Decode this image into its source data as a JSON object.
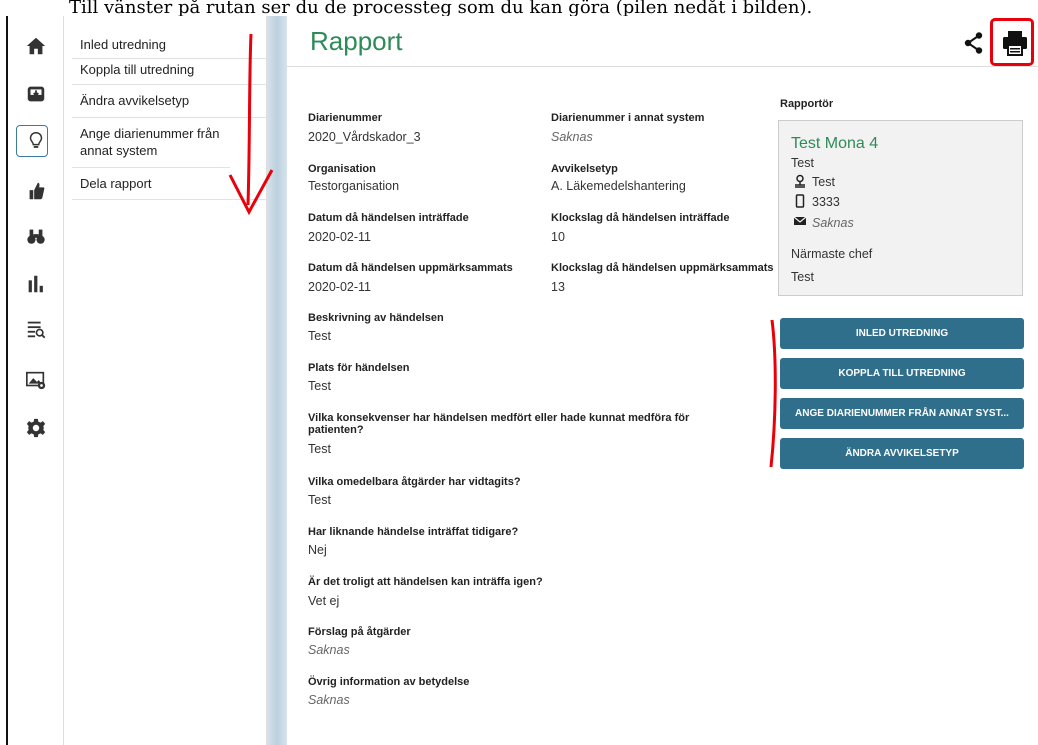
{
  "caption": "Till vänster på rutan ser du de processteg som du kan göra (pilen nedåt i bilden).",
  "rail": {
    "items": [
      {
        "icon": "home-icon"
      },
      {
        "icon": "inbox-icon"
      },
      {
        "icon": "lightbulb-icon",
        "active": true
      },
      {
        "icon": "thumbs-up-icon"
      },
      {
        "icon": "binoculars-icon"
      },
      {
        "icon": "bar-chart-icon"
      },
      {
        "icon": "search-list-icon"
      },
      {
        "icon": "image-settings-icon"
      },
      {
        "icon": "gear-icon"
      }
    ]
  },
  "menu": {
    "items": [
      "Inled utredning",
      "Koppla till utredning",
      "Ändra avvikelsetyp",
      "Ange diarienummer från annat system",
      "Dela rapport"
    ]
  },
  "page": {
    "title": "Rapport",
    "icons": {
      "share": "share-icon",
      "print": "print-icon"
    }
  },
  "fields": {
    "diarienummer_label": "Diarienummer",
    "diarienummer_value": "2020_Vårdskador_3",
    "annat_label": "Diarienummer i annat system",
    "annat_value": "Saknas",
    "org_label": "Organisation",
    "org_value": "Testorganisation",
    "typ_label": "Avvikelsetyp",
    "typ_value": "A. Läkemedelshantering",
    "datum_label": "Datum då händelsen inträffade",
    "datum_value": "2020-02-11",
    "klock_label": "Klockslag då händelsen inträffade",
    "klock_value": "10",
    "datum2_label": "Datum då händelsen uppmärksammats",
    "datum2_value": "2020-02-11",
    "klock2_label": "Klockslag då händelsen uppmärksammats",
    "klock2_value": "13",
    "beskr_label": "Beskrivning av händelsen",
    "beskr_value": "Test",
    "plats_label": "Plats för händelsen",
    "plats_value": "Test",
    "kons_label": "Vilka konsekvenser har händelsen medfört eller hade kunnat medföra för patienten?",
    "kons_value": "Test",
    "atg_label": "Vilka omedelbara åtgärder har vidtagits?",
    "atg_value": "Test",
    "lik_label": "Har liknande händelse inträffat tidigare?",
    "lik_value": "Nej",
    "igen_label": "Är det troligt att händelsen kan inträffa igen?",
    "igen_value": "Vet ej",
    "forslag_label": "Förslag på åtgärder",
    "forslag_value": "Saknas",
    "ovrig_label": "Övrig information av betydelse",
    "ovrig_value": "Saknas"
  },
  "reporter": {
    "label": "Rapportör",
    "name": "Test Mona 4",
    "title": "Test",
    "location": "Test",
    "phone": "3333",
    "email": "Saknas",
    "manager_label": "Närmaste chef",
    "manager": "Test"
  },
  "actions": [
    "INLED UTREDNING",
    "KOPPLA TILL UTREDNING",
    "ANGE DIARIENUMMER FRÅN ANNAT SYST...",
    "ÄNDRA AVVIKELSETYP"
  ],
  "colors": {
    "accent": "#2e8b57",
    "button": "#2f6f8c",
    "annotation": "#e8000b"
  }
}
